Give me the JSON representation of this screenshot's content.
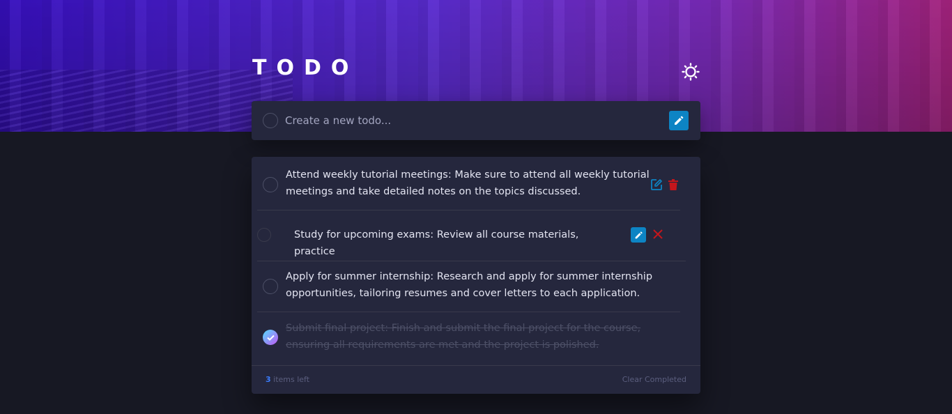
{
  "header": {
    "title": "TODO"
  },
  "theme_toggle": {
    "icon": "sun-icon"
  },
  "new_todo": {
    "placeholder": "Create a new todo..."
  },
  "todos": [
    {
      "line1": "Attend weekly tutorial meetings: Make sure to attend all weekly tutorial",
      "line2": "meetings and take detailed notes on the topics discussed.",
      "completed": false
    },
    {
      "line1": "Study for upcoming exams: Review all course materials, practice",
      "editing": true,
      "completed": false
    },
    {
      "line1": "Apply for summer internship: Research and apply for summer internship",
      "line2": "opportunities, tailoring resumes and cover letters to each application.",
      "completed": false
    },
    {
      "line1": "Submit final project: Finish and submit the final project for the course,",
      "line2": "ensuring all requirements are met and the project is polished.",
      "completed": true
    }
  ],
  "footer": {
    "count": "3",
    "items_left_label": "items left",
    "clear_label": "Clear Completed"
  },
  "colors": {
    "accent": "#0d84c4",
    "delete": "#c4161c",
    "check_gradient": [
      "#55ddff",
      "#c058f3"
    ],
    "count": "#3a7cfd"
  }
}
